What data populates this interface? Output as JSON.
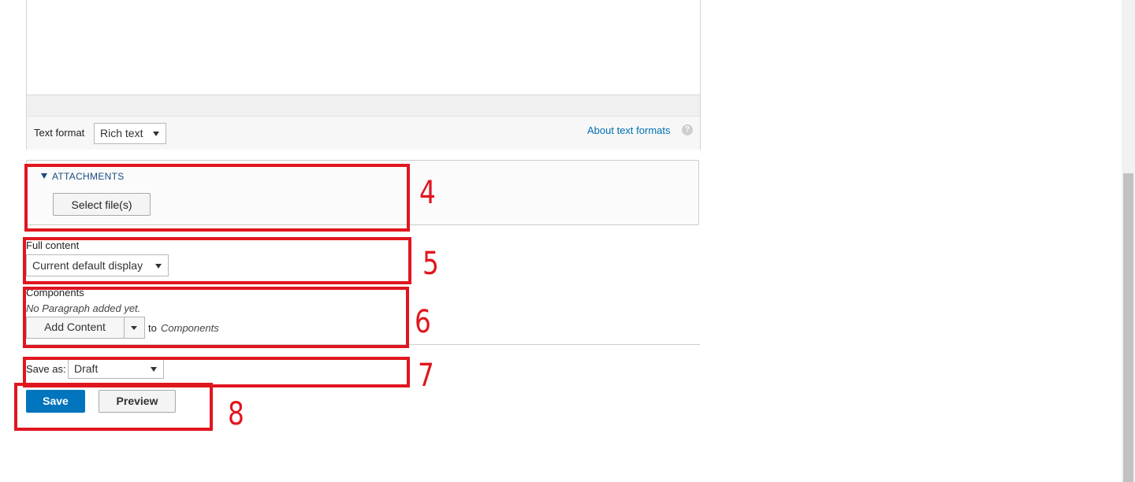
{
  "text_format": {
    "label": "Text format",
    "selected": "Rich text",
    "about_link": "About text formats",
    "help_icon_glyph": "?"
  },
  "attachments": {
    "toggle_label": "ATTACHMENTS",
    "select_button": "Select file(s)"
  },
  "full_content": {
    "label": "Full content",
    "selected": "Current default display"
  },
  "components": {
    "label": "Components",
    "empty_note": "No Paragraph added yet.",
    "add_button": "Add Content",
    "to_text": "to",
    "target": "Components"
  },
  "save_as": {
    "label": "Save as:",
    "selected": "Draft"
  },
  "actions": {
    "save": "Save",
    "preview": "Preview"
  },
  "annotations": [
    "4",
    "5",
    "6",
    "7",
    "8"
  ],
  "colors": {
    "annotation_red": "#e0161f",
    "primary_blue": "#0074bd",
    "link_blue": "#0071b3"
  }
}
